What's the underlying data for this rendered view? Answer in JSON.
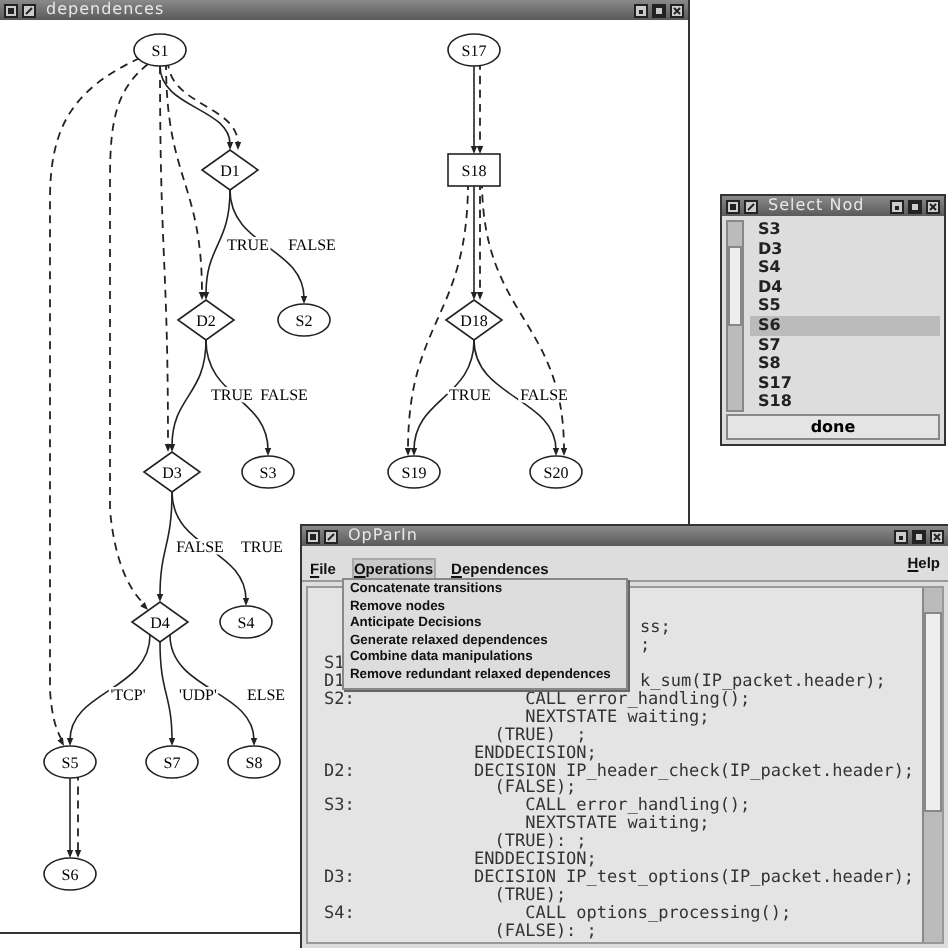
{
  "graph_window": {
    "title": "dependences",
    "nodes": [
      {
        "label": "S1",
        "kind": "state"
      },
      {
        "label": "D1",
        "kind": "decision"
      },
      {
        "label": "D2",
        "kind": "decision"
      },
      {
        "label": "S2",
        "kind": "state"
      },
      {
        "label": "D3",
        "kind": "decision"
      },
      {
        "label": "S3",
        "kind": "state"
      },
      {
        "label": "D4",
        "kind": "decision"
      },
      {
        "label": "S4",
        "kind": "state"
      },
      {
        "label": "S5",
        "kind": "state"
      },
      {
        "label": "S7",
        "kind": "state"
      },
      {
        "label": "S8",
        "kind": "state"
      },
      {
        "label": "S6",
        "kind": "state"
      },
      {
        "label": "S17",
        "kind": "state"
      },
      {
        "label": "S18",
        "kind": "task"
      },
      {
        "label": "D18",
        "kind": "decision"
      },
      {
        "label": "S19",
        "kind": "state"
      },
      {
        "label": "S20",
        "kind": "state"
      }
    ],
    "edge_labels": [
      "TRUE",
      "FALSE",
      "TRUE",
      "FALSE",
      "FALSE",
      "TRUE",
      "'TCP'",
      "'UDP'",
      "ELSE",
      "TRUE",
      "FALSE"
    ]
  },
  "node_selector": {
    "title": "Select Nod",
    "items": [
      {
        "label": "S3",
        "selected": false
      },
      {
        "label": "D3",
        "selected": false
      },
      {
        "label": "S4",
        "selected": false
      },
      {
        "label": "D4",
        "selected": false
      },
      {
        "label": "S5",
        "selected": false
      },
      {
        "label": "S6",
        "selected": true
      },
      {
        "label": "S7",
        "selected": false
      },
      {
        "label": "S8",
        "selected": false
      },
      {
        "label": "S17",
        "selected": false
      },
      {
        "label": "S18",
        "selected": false
      }
    ],
    "button": "done"
  },
  "editor_window": {
    "title": "OpParIn",
    "menus": [
      {
        "label": "File",
        "open": false
      },
      {
        "label": "Operations",
        "open": true
      },
      {
        "label": "Dependences",
        "open": false
      }
    ],
    "help_menu": "Help",
    "open_menu_items": [
      "Concatenate transitions",
      "Remove nodes",
      "Anticipate Decisions",
      "Generate relaxed dependences",
      "Combine data manipulations",
      "Remove redundant relaxed dependences"
    ],
    "code_lines": [
      {
        "kind": "fragment",
        "text": "ss;"
      },
      {
        "kind": "fragment",
        "text": ";"
      },
      {
        "label": "S1"
      },
      {
        "label": "D1",
        "kind": "fragment",
        "text": "k_sum(IP_packet.header);"
      },
      {
        "label": "S2:",
        "text": "     CALL error_handling();"
      },
      {
        "text": "     NEXTSTATE waiting;"
      },
      {
        "text": "  (TRUE)  ;"
      },
      {
        "text": "ENDDECISION;"
      },
      {
        "label": "D2:",
        "text": "DECISION IP_header_check(IP_packet.header);"
      },
      {
        "text": "  (FALSE);"
      },
      {
        "label": "S3:",
        "text": "     CALL error_handling();"
      },
      {
        "text": "     NEXTSTATE waiting;"
      },
      {
        "text": "  (TRUE): ;"
      },
      {
        "text": "ENDDECISION;"
      },
      {
        "label": "D3:",
        "text": "DECISION IP_test_options(IP_packet.header);"
      },
      {
        "text": "  (TRUE);"
      },
      {
        "label": "S4:",
        "text": "     CALL options_processing();"
      },
      {
        "text": "  (FALSE): ;"
      }
    ]
  }
}
